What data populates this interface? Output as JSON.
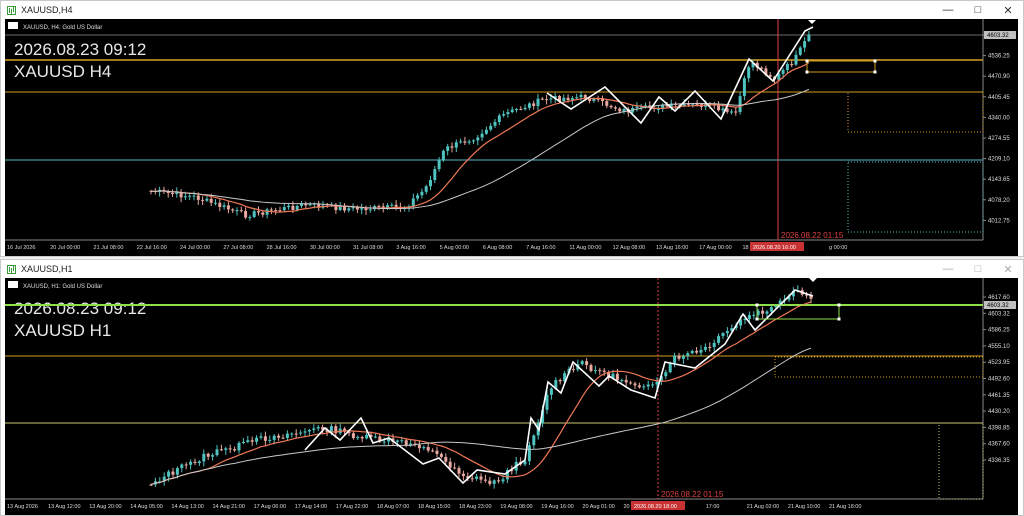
{
  "windows": [
    {
      "id": "h4",
      "title": "XAUUSD,H4",
      "symbol_info": "XAUUSD, H4:  Gold US Dollar",
      "overlay_datetime": "2026.08.23 09:12",
      "overlay_symbol": "XAUUSD H4",
      "price_ticks": [
        "4603.32",
        "4536.25",
        "4470.90",
        "4405.45",
        "4340.00",
        "4274.55",
        "4209.10",
        "4143.65",
        "4078.20",
        "4012.75"
      ],
      "current_price": "4603.32",
      "time_labels": [
        "16 Jul 2026",
        "20 Jul 00:00",
        "21 Jul 08:00",
        "22 Jul 16:00",
        "24 Jul 00:00",
        "27 Jul 08:00",
        "28 Jul 16:00",
        "30 Jul 00:00",
        "31 Jul 08:00",
        "3 Aug 16:00",
        "5 Aug 00:00",
        "6 Aug 08:00",
        "7 Aug 16:00",
        "11 Aug 00:00",
        "12 Aug 08:00",
        "13 Aug 16:00",
        "17 Aug 00:00",
        "18 Aug 08:00",
        "19",
        "g 00:00"
      ],
      "crosshair_time": "2026.08.20 16:00",
      "vline_label": "2026.08.22 01:15"
    },
    {
      "id": "h1",
      "title": "XAUUSD,H1",
      "symbol_info": "XAUUSD, H1:  Gold US Dollar",
      "overlay_datetime": "2026.08.23 09:12",
      "overlay_symbol": "XAUUSD H1",
      "price_ticks": [
        "4617.60",
        "4603.32",
        "4586.25",
        "4555.10",
        "4523.95",
        "4492.60",
        "4461.35",
        "4430.20",
        "4398.85",
        "4367.60",
        "4336.35"
      ],
      "current_price": "4603.32",
      "time_labels": [
        "13 Aug 2026",
        "13 Aug 12:00",
        "13 Aug 20:00",
        "14 Aug 05:00",
        "14 Aug 13:00",
        "14 Aug 21:00",
        "17 Aug 06:00",
        "17 Aug 14:00",
        "17 Aug 22:00",
        "18 Aug 07:00",
        "18 Aug 15:00",
        "18 Aug 23:00",
        "19 Aug 08:00",
        "19 Aug 16:00",
        "20 Aug 01:00",
        "20 Aug 09:00",
        "20",
        "17:00",
        "21 Aug 02:00",
        "21 Aug 10:00",
        "21 Aug 18:00"
      ],
      "crosshair_time": "2026.08.20 18:00",
      "vline_label": "2026.08.22 01:15"
    }
  ],
  "colors": {
    "bull": "#4fc3c0",
    "bear": "#e9a8a0",
    "ma_fast": "#f07856",
    "ma_slow": "#c8c8c8",
    "zigzag": "#ffffff",
    "level_orange": "#d4a020",
    "level_green": "#8ee04a",
    "level_cyan": "#57b9c8",
    "vline": "#e04040"
  }
}
